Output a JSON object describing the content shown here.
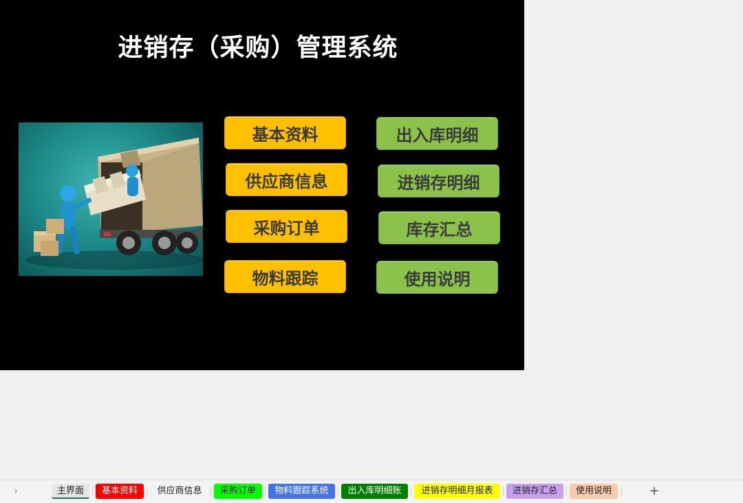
{
  "title": "进销存（采购）管理系统",
  "menu": {
    "basic_info": "基本资料",
    "supplier_info": "供应商信息",
    "purchase_order": "采购订单",
    "material_tracking": "物料跟踪",
    "inout_detail": "出入库明细",
    "psi_detail": "进销存明细",
    "inventory_summary": "库存汇总",
    "usage_guide": "使用说明"
  },
  "tabs": [
    {
      "label": "主界面",
      "color": "#e6e6e6",
      "text_color": "#222222"
    },
    {
      "label": "基本资料",
      "color": "#ff0000",
      "text_color": "#ffffff"
    },
    {
      "label": "供应商信息",
      "color": "#f3f3f3",
      "text_color": "#222222"
    },
    {
      "label": "采购订单",
      "color": "#00ff00",
      "text_color": "#222222"
    },
    {
      "label": "物料跟踪系统",
      "color": "#4472e8",
      "text_color": "#ffffff"
    },
    {
      "label": "出入库明细账",
      "color": "#008000",
      "text_color": "#ffffff"
    },
    {
      "label": "进销存明细月报表",
      "color": "#ffff00",
      "text_color": "#222222"
    },
    {
      "label": "进销存汇总",
      "color": "#c9a0f0",
      "text_color": "#222222"
    },
    {
      "label": "使用说明",
      "color": "#f8cbad",
      "text_color": "#222222"
    }
  ],
  "icons": {
    "tab_scroll": "chevron-right-icon",
    "add_sheet": "plus-icon"
  },
  "colors": {
    "menu_orange": "#ffc000",
    "menu_green": "#8bc34a",
    "panel_bg": "#000000"
  }
}
